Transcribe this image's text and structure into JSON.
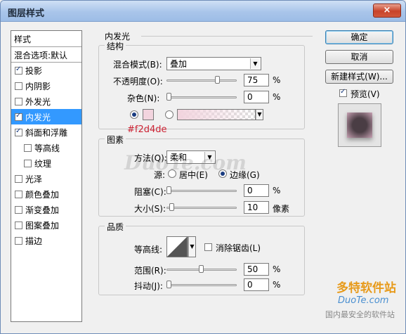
{
  "window": {
    "title": "图层样式",
    "close": "×"
  },
  "style_list": {
    "header": "样式",
    "blend_options": "混合选项:默认",
    "items": [
      {
        "label": "投影",
        "checked": true,
        "sub": false,
        "selected": false
      },
      {
        "label": "内阴影",
        "checked": false,
        "sub": false,
        "selected": false
      },
      {
        "label": "外发光",
        "checked": false,
        "sub": false,
        "selected": false
      },
      {
        "label": "内发光",
        "checked": true,
        "sub": false,
        "selected": true
      },
      {
        "label": "斜面和浮雕",
        "checked": true,
        "sub": false,
        "selected": false
      },
      {
        "label": "等高线",
        "checked": false,
        "sub": true,
        "selected": false
      },
      {
        "label": "纹理",
        "checked": false,
        "sub": true,
        "selected": false
      },
      {
        "label": "光泽",
        "checked": false,
        "sub": false,
        "selected": false
      },
      {
        "label": "颜色叠加",
        "checked": false,
        "sub": false,
        "selected": false
      },
      {
        "label": "渐变叠加",
        "checked": false,
        "sub": false,
        "selected": false
      },
      {
        "label": "图案叠加",
        "checked": false,
        "sub": false,
        "selected": false
      },
      {
        "label": "描边",
        "checked": false,
        "sub": false,
        "selected": false
      }
    ]
  },
  "panel": {
    "title": "内发光",
    "structure": {
      "legend": "结构",
      "blend_mode_label": "混合模式(B):",
      "blend_mode_value": "叠加",
      "opacity_label": "不透明度(O):",
      "opacity_value": "75",
      "opacity_unit": "%",
      "opacity_level": 0.75,
      "noise_label": "杂色(N):",
      "noise_value": "0",
      "noise_unit": "%",
      "noise_level": 0,
      "glow_color": "#f2d4de",
      "color_hex_label": "#f2d4de"
    },
    "elements": {
      "legend": "图素",
      "method_label": "方法(Q):",
      "method_value": "柔和",
      "source_label": "源:",
      "source_center": "居中(E)",
      "source_edge": "边缘(G)",
      "choke_label": "阻塞(C):",
      "choke_value": "0",
      "choke_unit": "%",
      "choke_level": 0,
      "size_label": "大小(S):",
      "size_value": "10",
      "size_unit": "像素",
      "size_level": 0.04
    },
    "quality": {
      "legend": "品质",
      "contour_label": "等高线:",
      "antialias_label": "消除锯齿(L)",
      "antialias_checked": false,
      "range_label": "范围(R):",
      "range_value": "50",
      "range_unit": "%",
      "range_level": 0.5,
      "jitter_label": "抖动(J):",
      "jitter_value": "0",
      "jitter_unit": "%",
      "jitter_level": 0
    }
  },
  "buttons": {
    "ok": "确定",
    "cancel": "取消",
    "new_style": "新建样式(W)...",
    "preview_label": "预览(V)",
    "preview_checked": true
  },
  "watermark": {
    "center": "DuoTe.com",
    "corner_title": "多特软件站",
    "corner_url": "DuoTe.com",
    "corner_sub": "国内最安全的软件站"
  }
}
